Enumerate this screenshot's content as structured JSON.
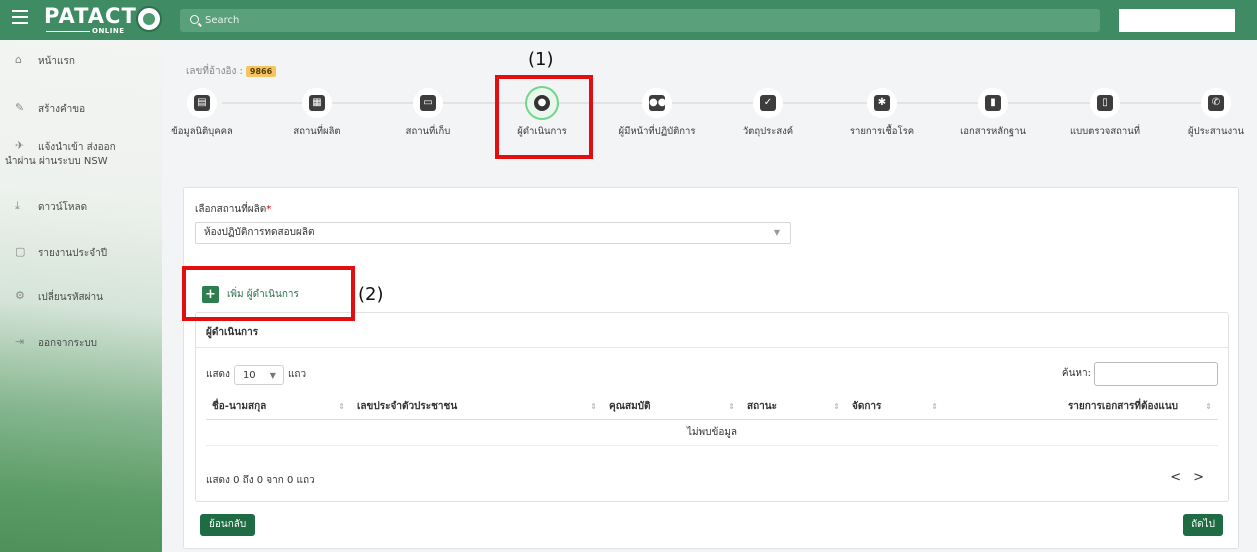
{
  "header": {
    "logo_text": "PATACT",
    "logo_sub": "ONLINE",
    "search_placeholder": "Search"
  },
  "sidebar": {
    "items": [
      {
        "icon": "home-icon",
        "label": "หน้าแรก"
      },
      {
        "icon": "pencil-icon",
        "label": "สร้างคำขอ"
      },
      {
        "icon": "plane-icon",
        "label": "แจ้งนำเข้า ส่งออก",
        "label2": "นำผ่าน ผ่านระบบ NSW"
      },
      {
        "icon": "download-icon",
        "label": "ดาวน์โหลด"
      },
      {
        "icon": "document-icon",
        "label": "รายงานประจำปี"
      },
      {
        "icon": "gears-icon",
        "label": "เปลี่ยนรหัสผ่าน"
      },
      {
        "icon": "logout-icon",
        "label": "ออกจากระบบ"
      }
    ]
  },
  "reference": {
    "label": "เลขที่อ้างอิง :",
    "value": "9866"
  },
  "steps": [
    {
      "icon": "id-card-icon",
      "glyph": "▤",
      "label": "ข้อมูลนิติบุคคล"
    },
    {
      "icon": "building-icon",
      "glyph": "▦",
      "label": "สถานที่ผลิต"
    },
    {
      "icon": "archive-icon",
      "glyph": "▭",
      "label": "สถานที่เก็บ"
    },
    {
      "icon": "user-icon",
      "glyph": "●",
      "label": "ผู้ดำเนินการ",
      "active": true
    },
    {
      "icon": "users-icon",
      "glyph": "●●",
      "label": "ผู้มีหน้าที่ปฏิบัติการ"
    },
    {
      "icon": "checkbox-icon",
      "glyph": "✓",
      "label": "วัตถุประสงค์"
    },
    {
      "icon": "virus-icon",
      "glyph": "✱",
      "label": "รายการเชื้อโรค"
    },
    {
      "icon": "file-icon",
      "glyph": "▮",
      "label": "เอกสารหลักฐาน"
    },
    {
      "icon": "clipboard-icon",
      "glyph": "▯",
      "label": "แบบตรวจสถานที่"
    },
    {
      "icon": "phone-icon",
      "glyph": "✆",
      "label": "ผู้ประสานงาน"
    }
  ],
  "annotations": {
    "a1": "(1)",
    "a2": "(2)"
  },
  "form": {
    "place_label": "เลือกสถานที่ผลิต",
    "required_mark": "*",
    "place_value": "ห้องปฏิบัติการทดสอบผลิต",
    "add_label": "เพิ่ม ผู้ดำเนินการ"
  },
  "panel": {
    "title": "ผู้ดำเนินการ",
    "show_label": "แสดง",
    "page_size": "10",
    "rows_label": "แถว",
    "search_label": "ค้นหา:",
    "columns": [
      "ชื่อ-นามสกุล",
      "เลขประจำตัวประชาชน",
      "คุณสมบัติ",
      "สถานะ",
      "จัดการ",
      "รายการเอกสารที่ต้องแนบ"
    ],
    "empty_text": "ไม่พบข้อมูล",
    "info": "แสดง 0 ถึง 0 จาก 0 แถว",
    "prev": "<",
    "next": ">"
  },
  "buttons": {
    "back": "ย้อนกลับ",
    "next": "ถัดไป"
  }
}
